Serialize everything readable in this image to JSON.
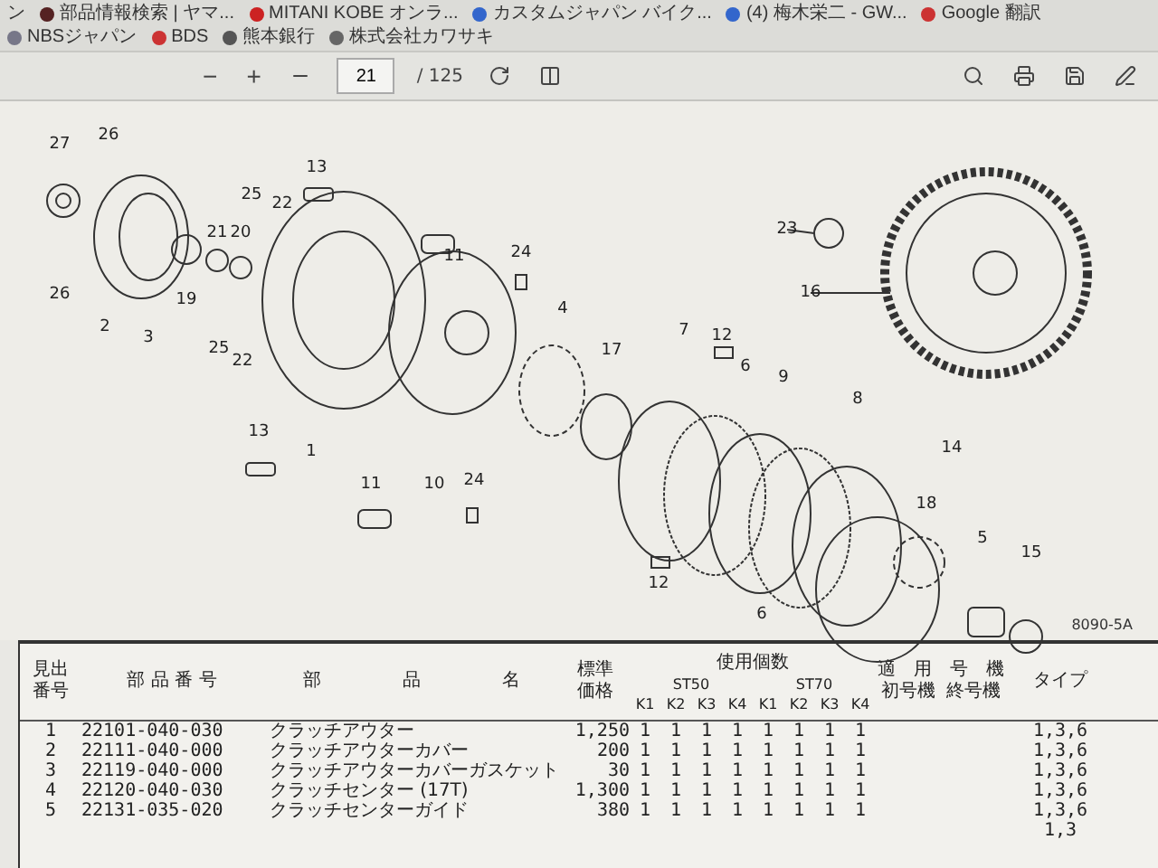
{
  "bookmarks": [
    {
      "label": "ン"
    },
    {
      "label": "部品情報検索 | ヤマ..."
    },
    {
      "label": "MITANI KOBE オンラ..."
    },
    {
      "label": "カスタムジャパン バイク..."
    },
    {
      "label": "(4) 梅木栄二 - GW..."
    },
    {
      "label": "Google 翻訳"
    },
    {
      "label": "NBSジャパン"
    },
    {
      "label": "BDS"
    },
    {
      "label": "熊本銀行"
    },
    {
      "label": "株式会社カワサキ"
    }
  ],
  "toolbar": {
    "zoom_out": "−",
    "zoom_in": "+",
    "page": "21",
    "page_total": "/ 125"
  },
  "diagram": {
    "callouts": [
      "27",
      "26",
      "26",
      "2",
      "3",
      "25",
      "22",
      "13",
      "21",
      "20",
      "19",
      "11",
      "24",
      "25",
      "22",
      "13",
      "1",
      "11",
      "10",
      "24",
      "4",
      "17",
      "7",
      "12",
      "6",
      "9",
      "8",
      "23",
      "16",
      "14",
      "18",
      "5",
      "15",
      "12",
      "6"
    ],
    "figure_code": "8090-5A"
  },
  "table": {
    "headers": {
      "index": [
        "見出",
        "番号"
      ],
      "part_no": "部 品 番 号",
      "name": [
        "部",
        "品",
        "名"
      ],
      "price": [
        "標準",
        "価格"
      ],
      "qty": "使用個数",
      "models": [
        "ST50",
        "ST70"
      ],
      "slots": [
        "K1",
        "K2",
        "K3",
        "K4",
        "K1",
        "K2",
        "K3",
        "K4"
      ],
      "serial": "適　用　号　機",
      "first": "初号機",
      "last": "終号機",
      "type": "タイプ"
    },
    "rows": [
      {
        "index": "1",
        "part_no": "22101-040-030",
        "name": "クラッチアウター",
        "price": "1,250",
        "counts": [
          "1",
          "1",
          "1",
          "1",
          "1",
          "1",
          "1",
          "1"
        ],
        "type": "1,3,6"
      },
      {
        "index": "2",
        "part_no": "22111-040-000",
        "name": "クラッチアウターカバー",
        "price": "200",
        "counts": [
          "1",
          "1",
          "1",
          "1",
          "1",
          "1",
          "1",
          "1"
        ],
        "type": "1,3,6"
      },
      {
        "index": "3",
        "part_no": "22119-040-000",
        "name": "クラッチアウターカバーガスケット",
        "price": "30",
        "counts": [
          "1",
          "1",
          "1",
          "1",
          "1",
          "1",
          "1",
          "1"
        ],
        "type": "1,3,6"
      },
      {
        "index": "4",
        "part_no": "22120-040-030",
        "name": "クラッチセンター (17T)",
        "price": "1,300",
        "counts": [
          "1",
          "1",
          "1",
          "1",
          "1",
          "1",
          "1",
          "1"
        ],
        "type": "1,3,6"
      },
      {
        "index": "5",
        "part_no": "22131-035-020",
        "name": "クラッチセンターガイド",
        "price": "380",
        "counts": [
          "1",
          "1",
          "1",
          "1",
          "1",
          "1",
          "1",
          "1"
        ],
        "type": "1,3,6"
      },
      {
        "type": "1,3"
      }
    ]
  }
}
